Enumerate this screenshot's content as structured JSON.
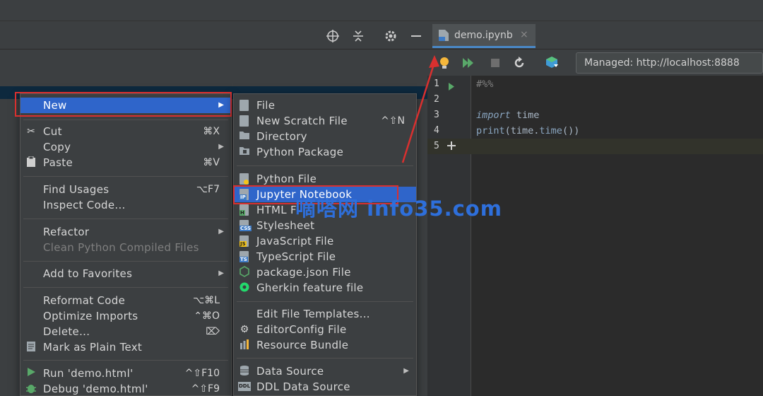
{
  "tab": {
    "label": "demo.ipynb",
    "close": "×"
  },
  "kernel": {
    "label": "Managed: http://localhost:8888"
  },
  "editor": {
    "line_numbers": [
      "1",
      "2",
      "3",
      "4",
      "5"
    ],
    "cell_marker": "#%%",
    "line3": {
      "keyword": "import",
      "rest": " time"
    },
    "line4": {
      "fn1": "print",
      "p1": "(time.",
      "fn2": "time",
      "p2": "())"
    }
  },
  "context_menu": {
    "new": "New",
    "cut": {
      "label": "Cut",
      "shortcut": "⌘X"
    },
    "copy": "Copy",
    "paste": {
      "label": "Paste",
      "shortcut": "⌘V"
    },
    "find_usages": {
      "label": "Find Usages",
      "shortcut": "⌥F7"
    },
    "inspect_code": "Inspect Code...",
    "refactor": "Refactor",
    "clean_python": "Clean Python Compiled Files",
    "add_favorites": "Add to Favorites",
    "reformat": {
      "label": "Reformat Code",
      "shortcut": "⌥⌘L"
    },
    "optimize": {
      "label": "Optimize Imports",
      "shortcut": "⌃⌘O"
    },
    "delete": {
      "label": "Delete...",
      "shortcut": "⌦"
    },
    "mark_plain": "Mark as Plain Text",
    "run": {
      "label": "Run 'demo.html'",
      "shortcut": "^⇧F10"
    },
    "debug": {
      "label": "Debug 'demo.html'",
      "shortcut": "^⇧F9"
    }
  },
  "submenu": {
    "file": "File",
    "scratch": {
      "label": "New Scratch File",
      "shortcut": "^⇧N"
    },
    "directory": "Directory",
    "python_package": "Python Package",
    "python_file": "Python File",
    "jupyter": "Jupyter Notebook",
    "html": "HTML F",
    "stylesheet": "Stylesheet",
    "javascript": "JavaScript File",
    "typescript": "TypeScript File",
    "package_json": "package.json File",
    "gherkin": "Gherkin feature file",
    "edit_templates": "Edit File Templates...",
    "editorconfig": "EditorConfig File",
    "resource_bundle": "Resource Bundle",
    "data_source": "Data Source",
    "ddl_source": "DDL Data Source"
  },
  "icons": {
    "file_tags": {
      "jupyter": "IP",
      "html": "H",
      "css": "CSS",
      "js": "JS",
      "ts": "TS",
      "ddl": "DDL",
      "tab": "IP"
    }
  },
  "watermark": "嘀嗒网 info35.com",
  "colors": {
    "selection": "#2f65ca",
    "highlight_red": "#d9302f",
    "watermark": "#2e6fdb"
  }
}
